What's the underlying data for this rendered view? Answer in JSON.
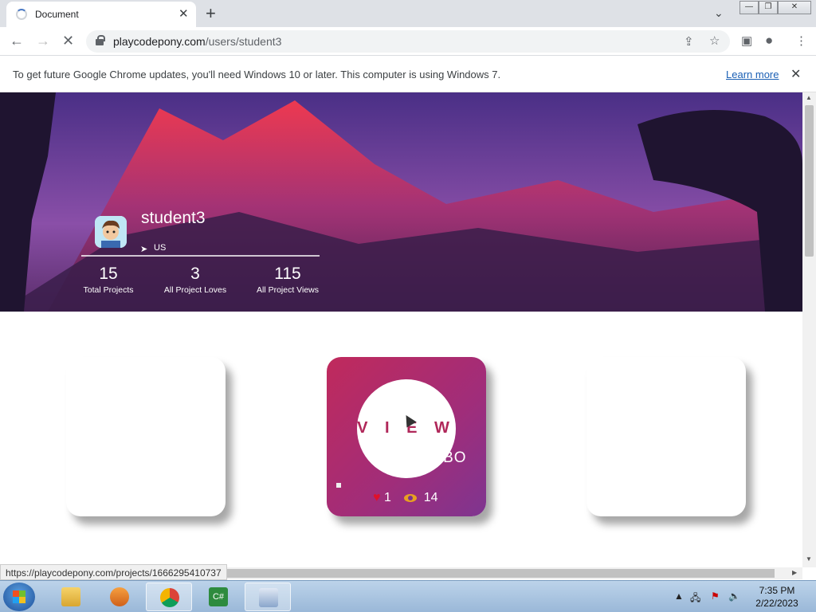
{
  "browser": {
    "tab_title": "Document",
    "url_host": "playcodepony.com",
    "url_path": "/users/student3",
    "window_controls": [
      "minimize",
      "restore",
      "close"
    ]
  },
  "infobar": {
    "message": "To get future Google Chrome updates, you'll need Windows 10 or later. This computer is using Windows 7.",
    "link": "Learn more"
  },
  "profile": {
    "username": "student3",
    "location": "US",
    "stats": [
      {
        "value": "15",
        "label": "Total Projects"
      },
      {
        "value": "3",
        "label": "All Project Loves"
      },
      {
        "value": "115",
        "label": "All Project Views"
      }
    ]
  },
  "project_card": {
    "view_label": "V I E W",
    "title": "... with AIBO",
    "loves": "1",
    "views": "14"
  },
  "status_bar": {
    "hover_url": "https://playcodepony.com/projects/1666295410737"
  },
  "taskbar": {
    "time": "7:35 PM",
    "date": "2/22/2023",
    "apps": [
      "file-explorer",
      "media-player",
      "chrome",
      "csharp-editor",
      "keyboard-app"
    ]
  }
}
